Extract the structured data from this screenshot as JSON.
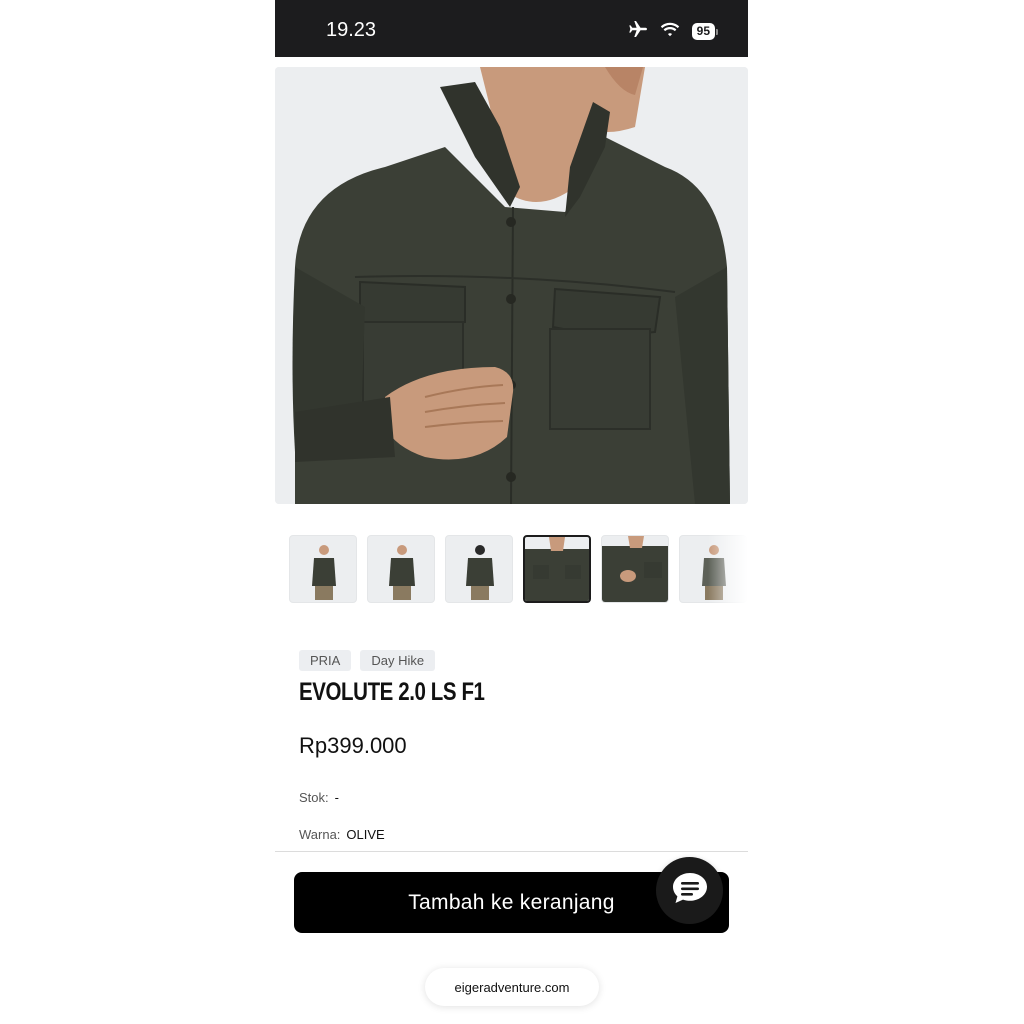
{
  "status_bar": {
    "time": "19.23",
    "battery": "95",
    "icons": [
      "airplane-icon",
      "wifi-icon",
      "battery-icon"
    ]
  },
  "product": {
    "hero_image": "olive-long-sleeve-shirt-photo",
    "thumbnails": [
      {
        "name": "front-full"
      },
      {
        "name": "front-angle"
      },
      {
        "name": "back"
      },
      {
        "name": "chest-closeup",
        "active": true
      },
      {
        "name": "pocket-closeup"
      },
      {
        "name": "front-full-2"
      }
    ],
    "tags": [
      "PRIA",
      "Day Hike"
    ],
    "title": "EVOLUTE 2.0 LS F1",
    "price": "Rp399.000",
    "stock_label": "Stok:",
    "stock_value": "-",
    "color_label": "Warna:",
    "color_value": "OLIVE"
  },
  "actions": {
    "add_to_cart": "Tambah ke keranjang",
    "chat_icon": "chat-icon"
  },
  "browser": {
    "url": "eigeradventure.com"
  },
  "colors": {
    "status_bar_bg": "#1c1c1e",
    "button_bg": "#000000",
    "shirt_olive": "#3b3f36",
    "image_bg": "#eceef0"
  }
}
